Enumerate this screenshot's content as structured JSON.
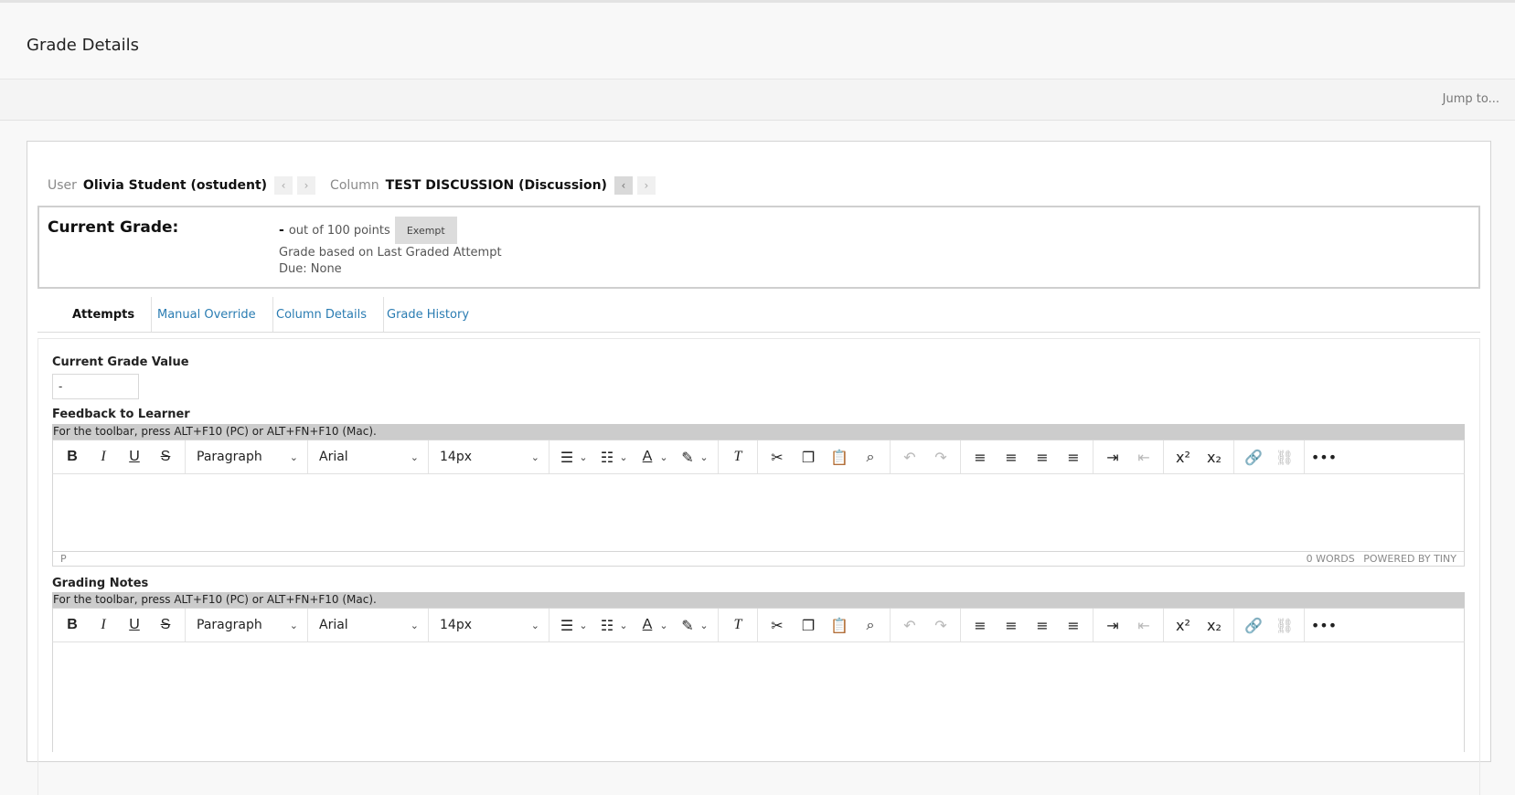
{
  "page": {
    "title": "Grade Details",
    "jump_label": "Jump to..."
  },
  "navigator": {
    "user_label": "User",
    "user_value": "Olivia Student (ostudent)",
    "column_label": "Column",
    "column_value": "TEST DISCUSSION (Discussion)"
  },
  "grade": {
    "title": "Current Grade:",
    "value": "-",
    "out_of": "out of 100 points",
    "exempt_label": "Exempt",
    "basis": "Grade based on Last Graded Attempt",
    "due": "Due: None"
  },
  "tabs": [
    "Attempts",
    "Manual Override",
    "Column Details",
    "Grade History"
  ],
  "form": {
    "current_grade_label": "Current Grade Value",
    "current_grade_value": "-",
    "feedback_label": "Feedback to Learner",
    "notes_label": "Grading Notes"
  },
  "editor": {
    "hint": "For the toolbar, press ALT+F10 (PC) or ALT+FN+F10 (Mac).",
    "block_format": "Paragraph",
    "font_family": "Arial",
    "font_size": "14px",
    "path": "P",
    "word_count": "0 WORDS",
    "powered_by": "POWERED BY TINY"
  },
  "icons": {
    "bold": "B",
    "italic": "I",
    "underline": "U",
    "strike": "S",
    "bullets": "☰",
    "numbers": "☷",
    "textcolor": "A",
    "highlight": "✎",
    "clear": "T",
    "cut": "✂",
    "copy": "❐",
    "paste": "📋",
    "find": "⌕",
    "undo": "↶",
    "redo": "↷",
    "al": "≡",
    "ac": "≡",
    "ar": "≡",
    "aj": "≡",
    "indent": "⇥",
    "outdent": "⇤",
    "sup": "x²",
    "sub": "x₂",
    "link": "🔗",
    "unlink": "⛓",
    "more": "•••",
    "chev_left": "‹",
    "chev_right": "›",
    "caret": "⌄"
  }
}
